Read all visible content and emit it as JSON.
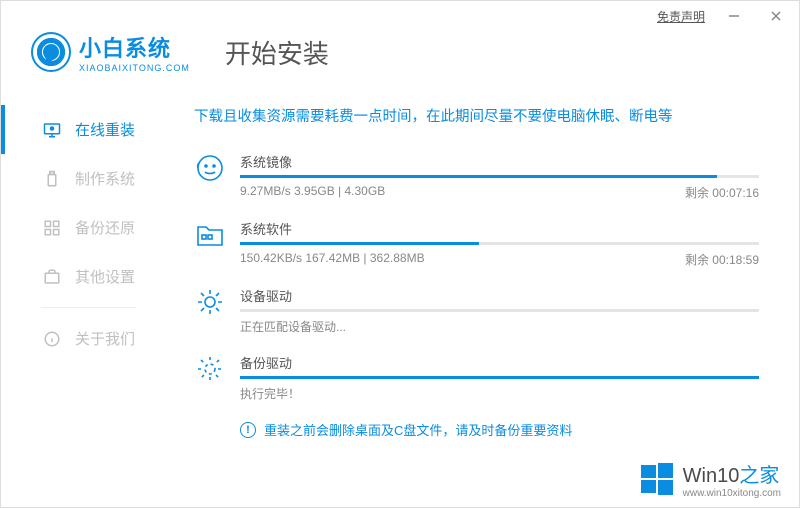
{
  "topbar": {
    "disclaimer": "免责声明"
  },
  "brand": {
    "name": "小白系统",
    "sub": "XIAOBAIXITONG.COM"
  },
  "page_title": "开始安装",
  "sidebar": {
    "items": [
      {
        "label": "在线重装"
      },
      {
        "label": "制作系统"
      },
      {
        "label": "备份还原"
      },
      {
        "label": "其他设置"
      },
      {
        "label": "关于我们"
      }
    ]
  },
  "subtitle": "下载且收集资源需要耗费一点时间，在此期间尽量不要使电脑休眠、断电等",
  "tasks": [
    {
      "title": "系统镜像",
      "detail": "9.27MB/s 3.95GB | 4.30GB",
      "remain": "剩余 00:07:16",
      "progress": 92
    },
    {
      "title": "系统软件",
      "detail": "150.42KB/s 167.42MB | 362.88MB",
      "remain": "剩余 00:18:59",
      "progress": 46
    },
    {
      "title": "设备驱动",
      "status": "正在匹配设备驱动...",
      "progress": 0
    },
    {
      "title": "备份驱动",
      "status": "执行完毕！",
      "progress": 100
    }
  ],
  "warning": "重装之前会删除桌面及C盘文件，请及时备份重要资料",
  "watermark": {
    "brand1": "Win10",
    "brand2": "之家",
    "url": "www.win10xitong.com"
  }
}
